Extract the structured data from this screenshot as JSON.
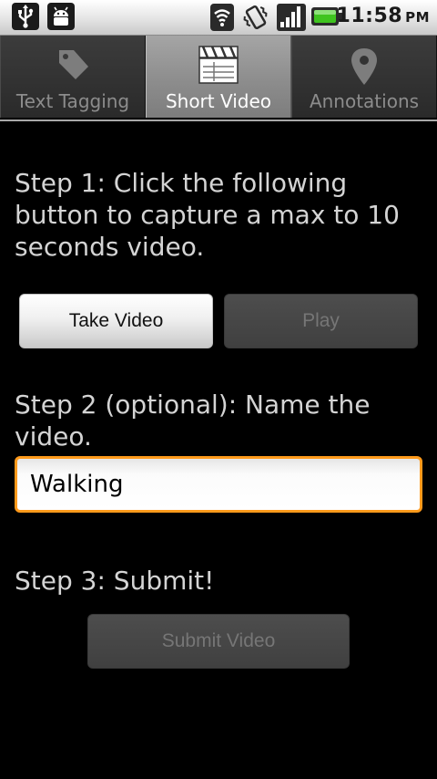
{
  "status_bar": {
    "time": "11:58",
    "ampm": "PM",
    "notification_icons": [
      "usb-icon",
      "android-debug-icon"
    ],
    "system_icons": [
      "wifi-icon",
      "vibrate-icon",
      "signal-icon",
      "battery-icon"
    ],
    "battery_color": "#3fc41f"
  },
  "tabs": [
    {
      "label": "Text Tagging",
      "icon": "tag-icon",
      "active": false
    },
    {
      "label": "Short Video",
      "icon": "clapperboard-icon",
      "active": true
    },
    {
      "label": "Annotations",
      "icon": "map-pin-icon",
      "active": false
    }
  ],
  "step1": {
    "text": "Step 1: Click the following button to capture a max to 10 seconds video.",
    "take_video_label": "Take Video",
    "play_label": "Play"
  },
  "step2": {
    "text": "Step 2 (optional): Name the video.",
    "name_value": "Walking"
  },
  "step3": {
    "text": "Step 3: Submit!",
    "submit_label": "Submit Video"
  },
  "colors": {
    "focus_border": "#ff9a1b",
    "background": "#000000",
    "step_text": "#d4d4d4"
  }
}
